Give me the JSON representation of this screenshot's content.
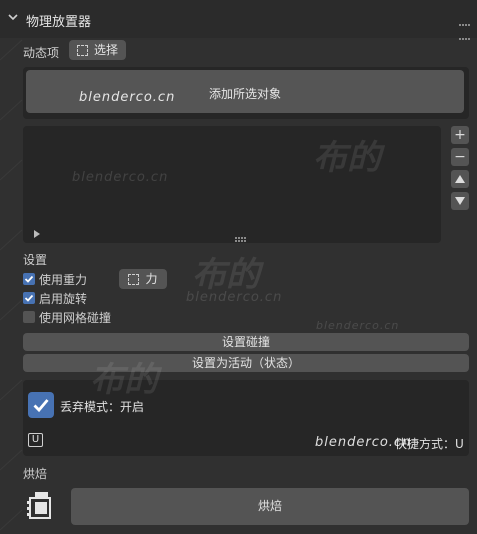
{
  "panel": {
    "title": "物理放置器"
  },
  "active_item": {
    "label": "动态项",
    "select_label": "选择"
  },
  "add_selected_button": "添加所选对象",
  "list": {
    "add": "+",
    "remove": "−"
  },
  "settings": {
    "section_label": "设置",
    "use_gravity": {
      "label": "使用重力",
      "checked": true
    },
    "force_label": "力",
    "enable_rotation": {
      "label": "启用旋转",
      "checked": true
    },
    "use_mesh_collision": {
      "label": "使用网格碰撞",
      "checked": false
    },
    "set_collision_button": "设置碰撞",
    "set_active_button": "设置为活动（状态）"
  },
  "drop_mode": {
    "label": "丢弃模式：开启",
    "checked": true,
    "key": "U",
    "shortcut": "快捷方式：U"
  },
  "bake": {
    "section_label": "烘焙",
    "button": "烘焙"
  },
  "watermark": {
    "brand": "布的",
    "url": "blenderco.cn"
  },
  "colors": {
    "accent": "#4772b3",
    "background": "#303030",
    "button": "#545454"
  }
}
